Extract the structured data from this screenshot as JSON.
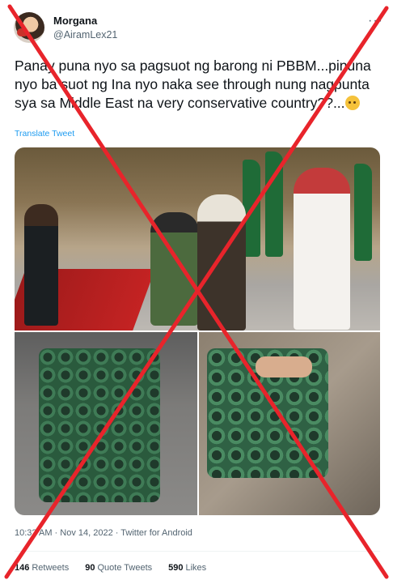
{
  "tweet": {
    "display_name": "Morgana",
    "handle": "@AiramLex21",
    "more_icon": "ellipsis-icon",
    "text": "Panay puna nyo sa pagsuot ng barong ni PBBM...pinuna nyo ba suot ng Ina nyo naka see through nung nagpunta sya sa Middle East na very conservative country??...",
    "emoji": "thinking-face-emoji",
    "translate_label": "Translate Tweet",
    "timestamp": "10:32 AM · Nov 14, 2022 · Twitter for Android",
    "stats": {
      "retweets_count": "146",
      "retweets_label": "Retweets",
      "quote_count": "90",
      "quote_label": "Quote Tweets",
      "likes_count": "590",
      "likes_label": "Likes"
    }
  },
  "overlay": {
    "mark": "red-x-cross",
    "color": "#e8242b"
  }
}
